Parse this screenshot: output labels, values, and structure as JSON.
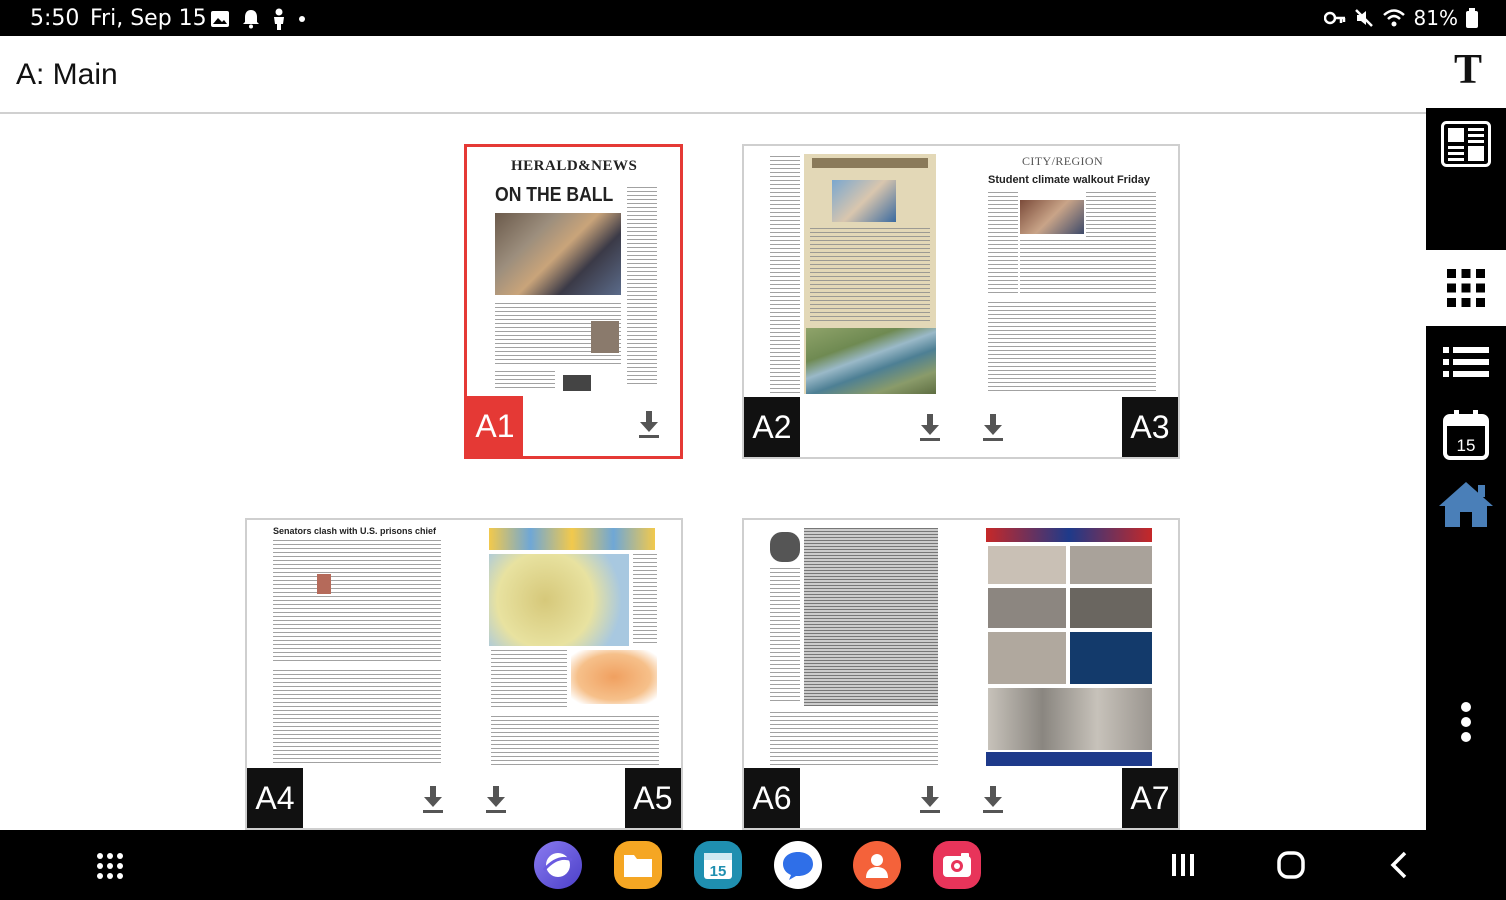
{
  "status_bar": {
    "time": "5:50",
    "date": "Fri, Sep 15",
    "battery": "81%",
    "left_icons": [
      "gallery-icon",
      "notification-bell-icon",
      "person-icon",
      "dot-icon"
    ],
    "right_icons": [
      "key-icon",
      "mute-icon",
      "wifi-icon",
      "battery-icon"
    ]
  },
  "header": {
    "section_title": "A: Main",
    "font_button_label": "T"
  },
  "rail": {
    "items": [
      "page-view-icon",
      "grid-view-icon",
      "list-view-icon",
      "calendar-icon",
      "home-icon",
      "more-options-icon"
    ],
    "selected": "grid-view-icon",
    "calendar_day": "15"
  },
  "pages": [
    {
      "label": "A1",
      "active": true,
      "masthead": "HERALD&NEWS",
      "headline": "ON THE BALL"
    },
    {
      "label": "A2",
      "masthead": ""
    },
    {
      "label": "A3",
      "masthead": "CITY/REGION",
      "headline": "Student climate walkout Friday"
    },
    {
      "label": "A4",
      "headline": "Senators clash with U.S. prisons chief"
    },
    {
      "label": "A5"
    },
    {
      "label": "A6"
    },
    {
      "label": "A7"
    }
  ],
  "colors": {
    "active_red": "#e53935",
    "label_black": "#111111"
  },
  "nav": {
    "apps": [
      "internet-app-icon",
      "my-files-app-icon",
      "calendar-app-icon",
      "messages-app-icon",
      "contacts-app-icon",
      "camera-app-icon"
    ],
    "calendar_app_day": "15"
  }
}
